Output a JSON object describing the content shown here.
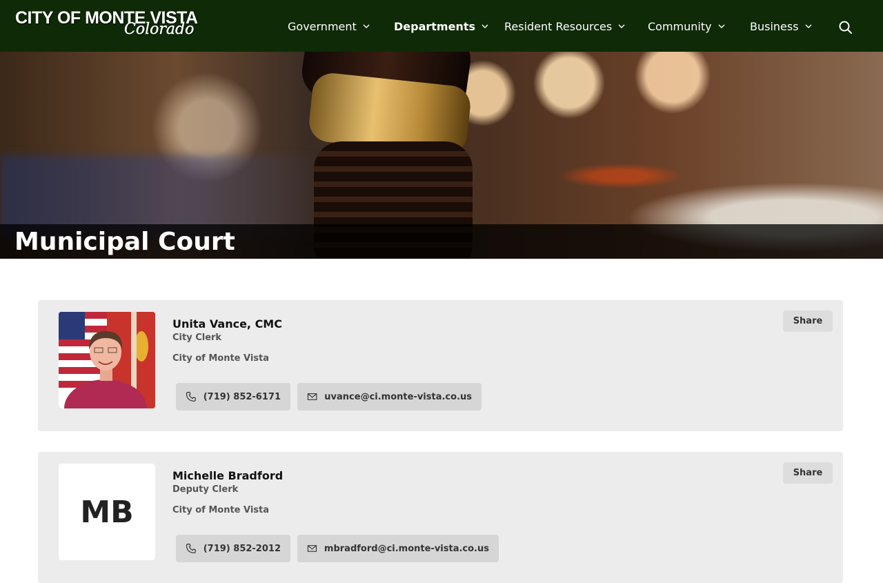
{
  "header": {
    "logo_main": "CITY OF MONTE VISTA",
    "logo_sub": "Colorado",
    "bg_color": "#0f2a06",
    "nav": [
      {
        "label": "Government",
        "active": false
      },
      {
        "label": "Departments",
        "active": true
      },
      {
        "label": "Resident Resources",
        "active": false
      },
      {
        "label": "Community",
        "active": false
      },
      {
        "label": "Business",
        "active": false
      }
    ],
    "search_icon": "search-icon"
  },
  "hero": {
    "title": "Municipal Court",
    "image": "gavel-photo"
  },
  "contacts": [
    {
      "name": "Unita Vance, CMC",
      "role": "City Clerk",
      "org": "City of Monte Vista",
      "phone": "(719) 852-6171",
      "email": "uvance@ci.monte-vista.co.us",
      "share_label": "Share",
      "has_photo": true
    },
    {
      "name": "Michelle Bradford",
      "role": "Deputy Clerk",
      "org": "City of Monte Vista",
      "initials": "MB",
      "phone": "(719) 852-2012",
      "email": "mbradford@ci.monte-vista.co.us",
      "share_label": "Share",
      "has_photo": false
    }
  ]
}
